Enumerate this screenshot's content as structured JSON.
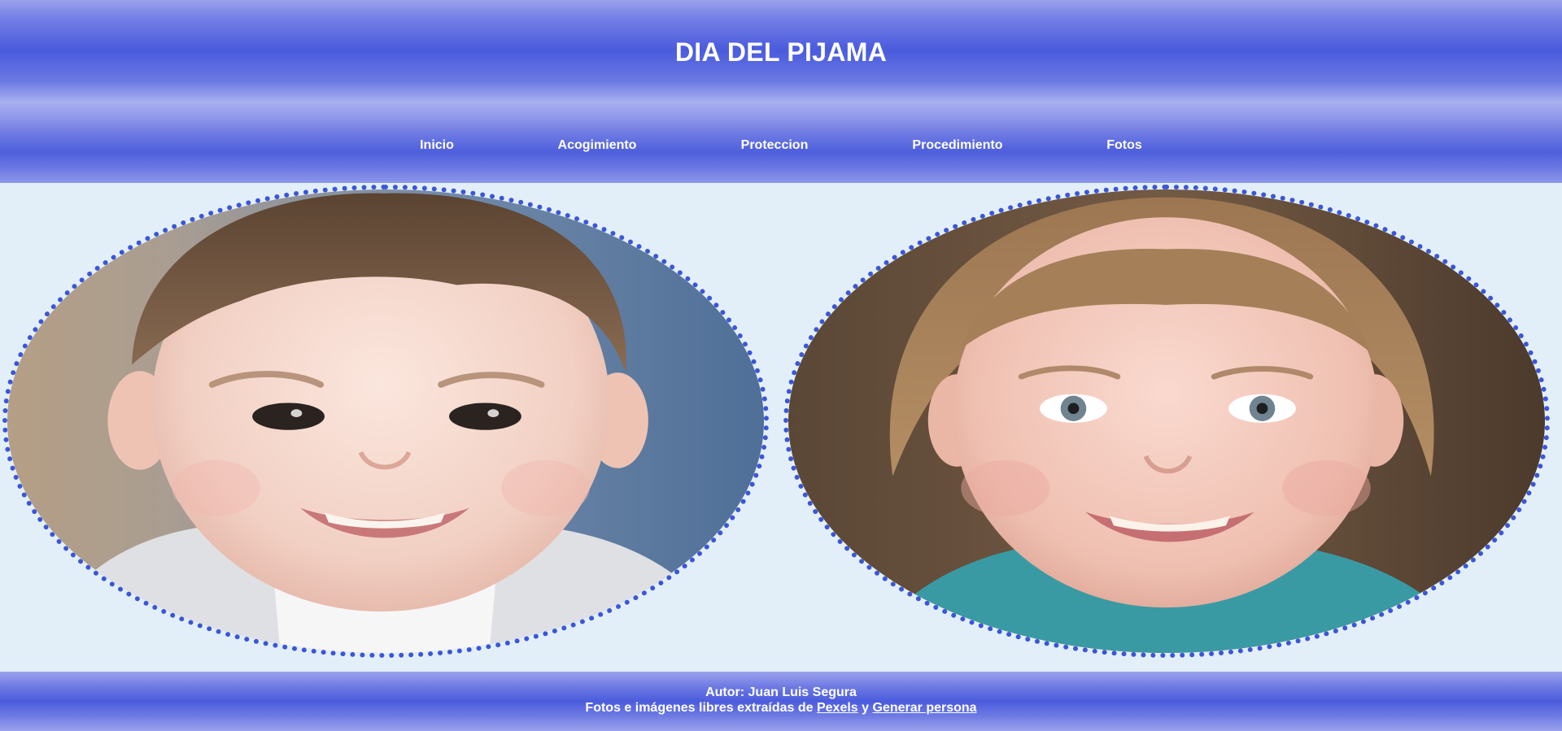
{
  "header": {
    "title": "DIA DEL PIJAMA"
  },
  "nav": {
    "items": [
      {
        "label": "Inicio"
      },
      {
        "label": "Acogimiento"
      },
      {
        "label": "Proteccion"
      },
      {
        "label": "Procedimiento"
      },
      {
        "label": "Fotos"
      }
    ]
  },
  "main": {
    "photos": [
      {
        "subject": "smiling toddler boy"
      },
      {
        "subject": "smiling young girl"
      }
    ]
  },
  "footer": {
    "author": "Autor: Juan Luis Segura",
    "credits_prefix": "Fotos e imágenes libres extraídas de ",
    "link1": "Pexels",
    "conjunction": " y ",
    "link2": "Generar persona"
  },
  "colors": {
    "accent": "#4a5bdd",
    "border_dots": "#3b56d8",
    "background": "#e3eff8",
    "text_light": "#ffffff"
  }
}
